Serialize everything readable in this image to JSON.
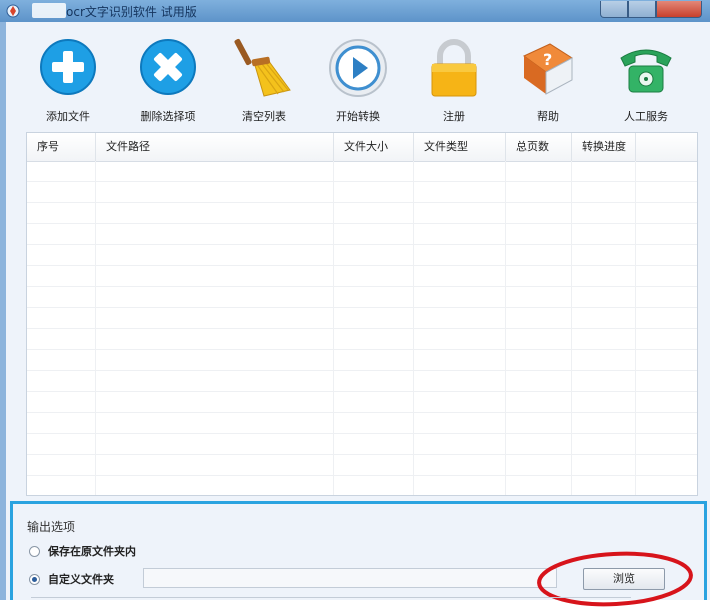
{
  "window": {
    "title": "ocr文字识别软件 试用版"
  },
  "toolbar": {
    "buttons": [
      {
        "label": "添加文件",
        "icon": "plus-icon"
      },
      {
        "label": "删除选择项",
        "icon": "delete-icon"
      },
      {
        "label": "清空列表",
        "icon": "broom-icon"
      },
      {
        "label": "开始转换",
        "icon": "play-icon"
      },
      {
        "label": "注册",
        "icon": "lock-icon"
      },
      {
        "label": "帮助",
        "icon": "help-book-icon"
      },
      {
        "label": "人工服务",
        "icon": "phone-icon"
      }
    ]
  },
  "table": {
    "columns": [
      "序号",
      "文件路径",
      "文件大小",
      "文件类型",
      "总页数",
      "转换进度"
    ],
    "rows": []
  },
  "output": {
    "title": "输出选项",
    "option_same_folder": "保存在原文件夹内",
    "option_custom_folder": "自定义文件夹",
    "selected": "自定义文件夹",
    "path_value": "",
    "browse_label": "浏览"
  },
  "colors": {
    "titlebar": "#6fa3d6",
    "accent_border": "#2aa3e0",
    "highlight_circle": "#d7141b"
  }
}
